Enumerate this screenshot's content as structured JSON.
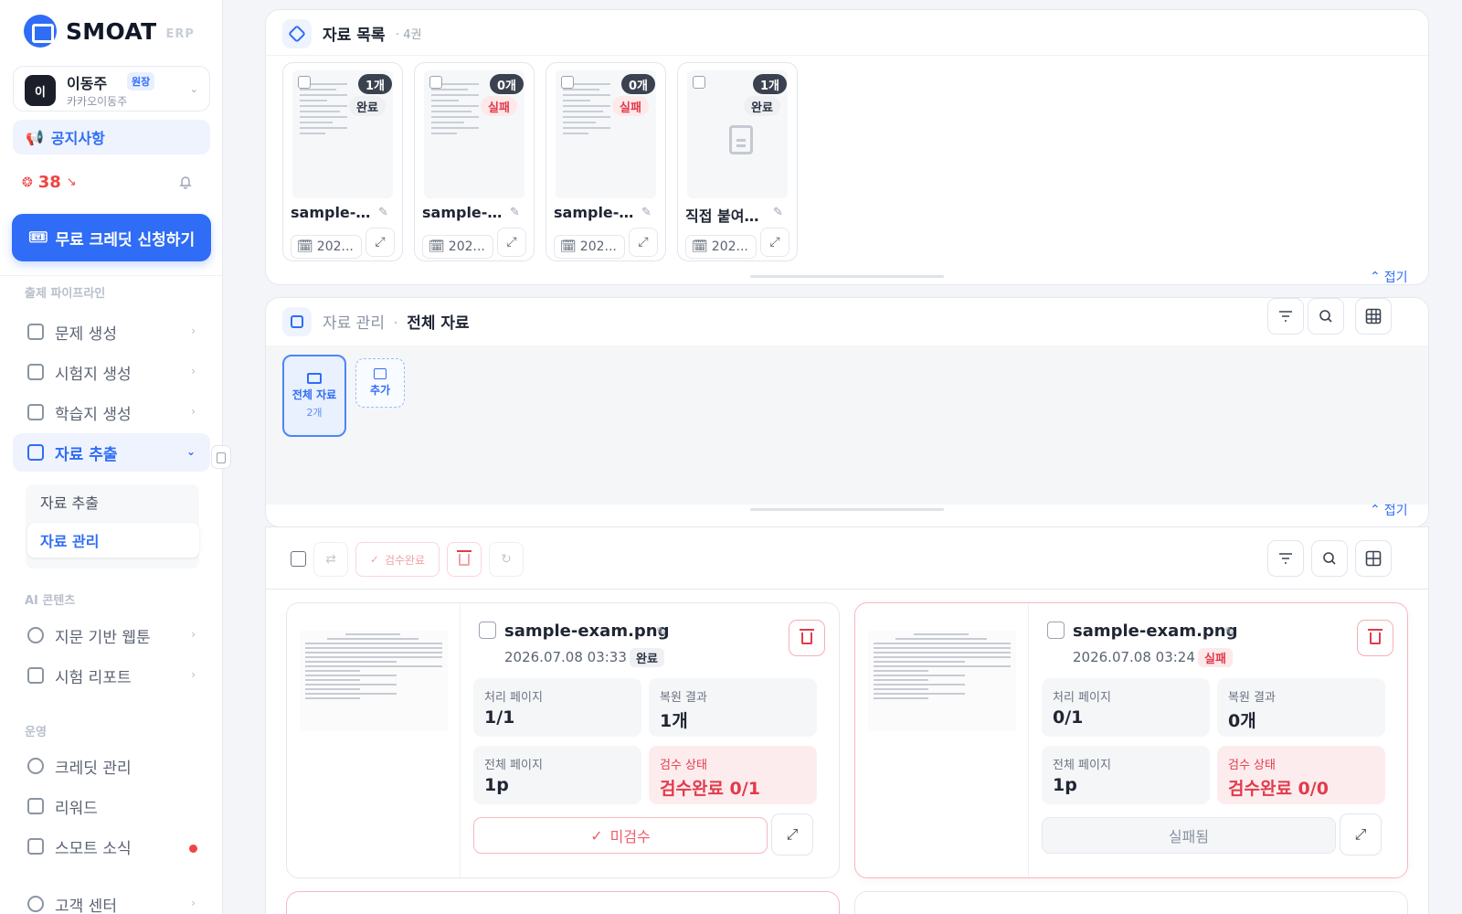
{
  "brand": {
    "name": "SMOAT",
    "suffix": "ERP"
  },
  "user": {
    "initial": "이",
    "name": "이동주",
    "role": "원장",
    "org": "카카오이동주"
  },
  "sidebar": {
    "notice_label": "공지사항",
    "credits": "38",
    "cta_label": "무료 크레딧 신청하기",
    "section_pipeline": "출제 파이프라인",
    "section_ai": "AI 콘텐츠",
    "section_ops": "운영",
    "items": [
      {
        "label": "문제 생성"
      },
      {
        "label": "시험지 생성"
      },
      {
        "label": "학습지 생성"
      },
      {
        "label": "자료 추출"
      },
      {
        "label": "지문 기반 웹툰"
      },
      {
        "label": "시험 리포트"
      },
      {
        "label": "크레딧 관리"
      },
      {
        "label": "리워드"
      },
      {
        "label": "스모트 소식"
      },
      {
        "label": "고객 센터"
      }
    ],
    "sub_items": [
      {
        "label": "자료 추출"
      },
      {
        "label": "자료 관리"
      }
    ]
  },
  "top_panel": {
    "title": "자료 목록",
    "count": "· 4권",
    "fold_label": "접기",
    "cards": [
      {
        "count": "1개",
        "status": "완료",
        "name": "sample-e...",
        "date": "202..."
      },
      {
        "count": "0개",
        "status": "실패",
        "name": "sample-e...",
        "date": "202..."
      },
      {
        "count": "0개",
        "status": "실패",
        "name": "sample-e...",
        "date": "202..."
      },
      {
        "count": "1개",
        "status": "완료",
        "name": "직접 붙여넣...",
        "date": "202..."
      }
    ]
  },
  "mid_panel": {
    "crumb_parent": "자료 관리",
    "crumb_sep": "·",
    "crumb_current": "전체 자료",
    "folder_label": "전체 자료",
    "folder_count": "2개",
    "add_label": "추가",
    "fold_label": "접기"
  },
  "toolbar": {
    "review_label": "검수완료"
  },
  "results": [
    {
      "name": "sample-exam.png",
      "date": "2026.07.08 03:33",
      "status": "완료",
      "stats": [
        {
          "label": "처리 페이지",
          "value": "1/1"
        },
        {
          "label": "복원 결과",
          "value": "1개"
        },
        {
          "label": "전체 페이지",
          "value": "1p"
        },
        {
          "label": "검수 상태",
          "value": "검수완료 0/1"
        }
      ],
      "action_label": "미검수"
    },
    {
      "name": "sample-exam.png",
      "date": "2026.07.08 03:24",
      "status": "실패",
      "stats": [
        {
          "label": "처리 페이지",
          "value": "0/1"
        },
        {
          "label": "복원 결과",
          "value": "0개"
        },
        {
          "label": "전체 페이지",
          "value": "1p"
        },
        {
          "label": "검수 상태",
          "value": "검수완료 0/0"
        }
      ],
      "action_label": "실패됨"
    }
  ],
  "colors": {
    "accent": "#2f6df6",
    "danger": "#e23b4b",
    "sidebar_bg": "#ffffff",
    "page_bg": "#f3f5f8"
  }
}
